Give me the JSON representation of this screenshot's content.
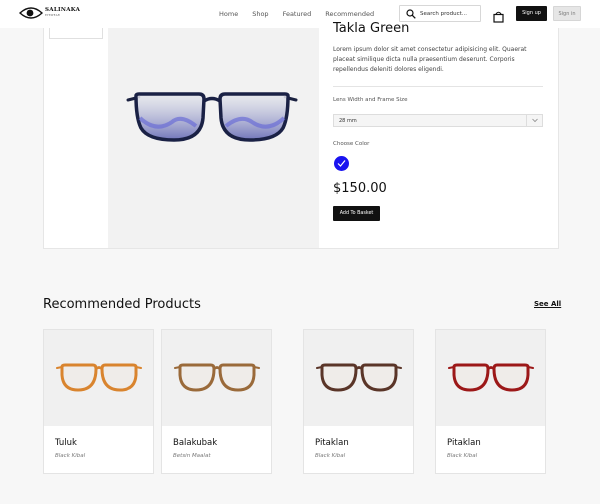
{
  "header": {
    "logo_text": "SALINAKA",
    "logo_sub": "EYEWEAR",
    "nav": [
      "Home",
      "Shop",
      "Featured",
      "Recommended"
    ],
    "search_placeholder": "Search product...",
    "signup_label": "Sign up",
    "signin_label": "Sign in"
  },
  "product": {
    "title": "Takla Green",
    "description": "Lorem ipsum dolor sit amet consectetur adipisicing elit. Quaerat placeat similique dicta nulla praesentium deserunt. Corporis repellendus deleniti dolores eligendi.",
    "size_label": "Lens Width and Frame Size",
    "size_value": "28 mm",
    "color_label": "Choose Color",
    "selected_color": "#1a13f0",
    "price": "$150.00",
    "add_label": "Add To Basket"
  },
  "recommended": {
    "title": "Recommended Products",
    "see_all": "See All",
    "items": [
      {
        "name": "Tuluk",
        "sub": "Black Kibal",
        "frame_color": "#d9842e"
      },
      {
        "name": "Balakubak",
        "sub": "Betsin Maalat",
        "frame_color": "#9a6a3a"
      },
      {
        "name": "Pitaklan",
        "sub": "Black Kibal",
        "frame_color": "#5a3528"
      },
      {
        "name": "Pitaklan",
        "sub": "Black Kibal",
        "frame_color": "#9c1818"
      }
    ]
  }
}
